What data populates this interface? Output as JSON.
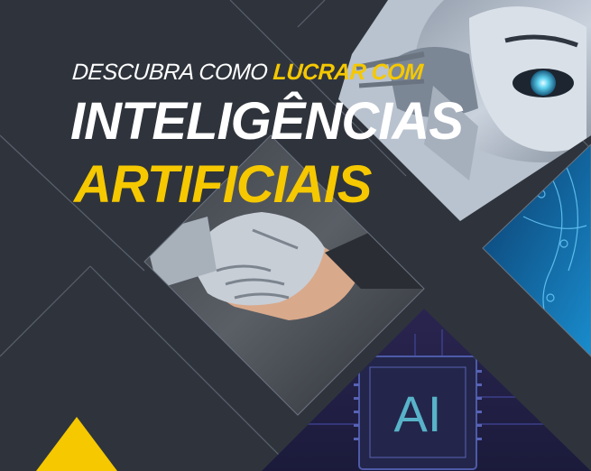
{
  "headline": {
    "tagline_prefix": "DESCUBRA COMO ",
    "tagline_accent": "LUCRAR COM",
    "title_line1": "INTELIGÊNCIAS",
    "title_line2": "ARTIFICIAIS"
  },
  "chip": {
    "label": "AI"
  },
  "colors": {
    "background": "#2f343c",
    "accent": "#f5c800",
    "white": "#ffffff"
  },
  "icons": [
    "robot-face-image",
    "handshake-image",
    "ai-chip-image",
    "circuit-blue-image",
    "yellow-triangle-icon"
  ]
}
